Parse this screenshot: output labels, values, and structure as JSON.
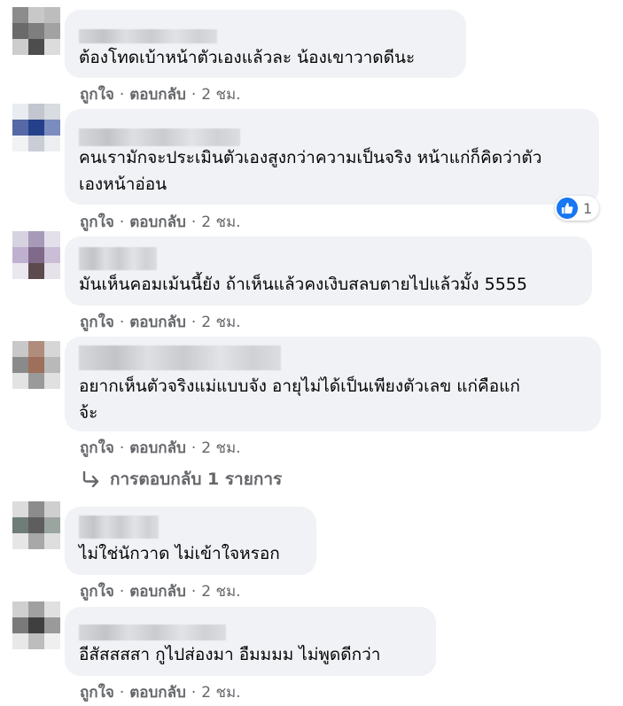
{
  "colors": {
    "bubble": "#f0f2f5",
    "meta_text": "#65676b",
    "like_blue": "#1877f2"
  },
  "comments": [
    {
      "text_lines": [
        "ต้องโทดเบ้าหน้าตัวเองแล้วละ น้องเขาวาดดีนะ"
      ],
      "like": "ถูกใจ",
      "reply": "ตอบกลับ",
      "time": "2 ชม.",
      "avatar": [
        "#8c8c8c",
        "#c8c8c8",
        "#bdbdbd",
        "#6a6a6a",
        "#7e7e7e",
        "#a2a2a2",
        "#cdcdcd",
        "#4d4d4d",
        "#dcdcdc"
      ]
    },
    {
      "text_lines": [
        "คนเรามักจะประเมินตัวเองสูงกว่าความเป็นจริง หน้าแก่ก็คิดว่าตัว",
        "เองหน้าอ่อน"
      ],
      "like": "ถูกใจ",
      "reply": "ตอบกลับ",
      "time": "2 ชม.",
      "reaction_count": "1",
      "avatar": [
        "#e9ecf1",
        "#c2c7cf",
        "#d8dbe0",
        "#5668a6",
        "#24408b",
        "#7b8cc0",
        "#f1f2f4",
        "#c9cdd6",
        "#eceef2"
      ]
    },
    {
      "text_lines": [
        "มันเห็นคอมเม้นนี้ยัง ถ้าเห็นแล้วคงเงิบสลบตายไปแล้วมั้ง 5555"
      ],
      "like": "ถูกใจ",
      "reply": "ตอบกลับ",
      "time": "2 ชม.",
      "avatar": [
        "#d7d2e0",
        "#a69ab8",
        "#e4e0ea",
        "#bfb0d0",
        "#7f6a8a",
        "#c9bed6",
        "#eae7ee",
        "#5c4a4f",
        "#e6e2ea"
      ]
    },
    {
      "text_lines": [
        "อยากเห็นตัวจริงแม่แบบจัง อายุไม่ได้เป็นเพียงตัวเลข แก่คือแก่",
        "จ้ะ"
      ],
      "like": "ถูกใจ",
      "reply": "ตอบกลับ",
      "time": "2 ชม.",
      "replies_label": "การตอบกลับ 1 รายการ",
      "avatar": [
        "#c8c8c8",
        "#b08c7c",
        "#d6d6d6",
        "#8a8a8a",
        "#9e6f5a",
        "#b9b9b9",
        "#e3e3e3",
        "#9a9a9a",
        "#e0e0e0"
      ]
    },
    {
      "text_lines": [
        "ไม่ใช่นักวาด ไม่เข้าใจหรอก"
      ],
      "like": "ถูกใจ",
      "reply": "ตอบกลับ",
      "time": "2 ชม.",
      "avatar": [
        "#dcdcdc",
        "#8c8c8c",
        "#cfcfcf",
        "#6f7c78",
        "#5e5e5e",
        "#9aa5a0",
        "#e6e6e6",
        "#a8a8a8",
        "#dedede"
      ]
    },
    {
      "text_lines": [
        "อีสัสสสสา กูไปส่องมา อืมมมม ไม่พูดดีกว่า"
      ],
      "like": "ถูกใจ",
      "reply": "ตอบกลับ",
      "time": "2 ชม.",
      "avatar": [
        "#d0d0d0",
        "#a0a0a0",
        "#e0e0e0",
        "#7a7a7a",
        "#3f3f3f",
        "#9a9a9a",
        "#e8e8e8",
        "#bdbdbd",
        "#efefef"
      ]
    }
  ]
}
